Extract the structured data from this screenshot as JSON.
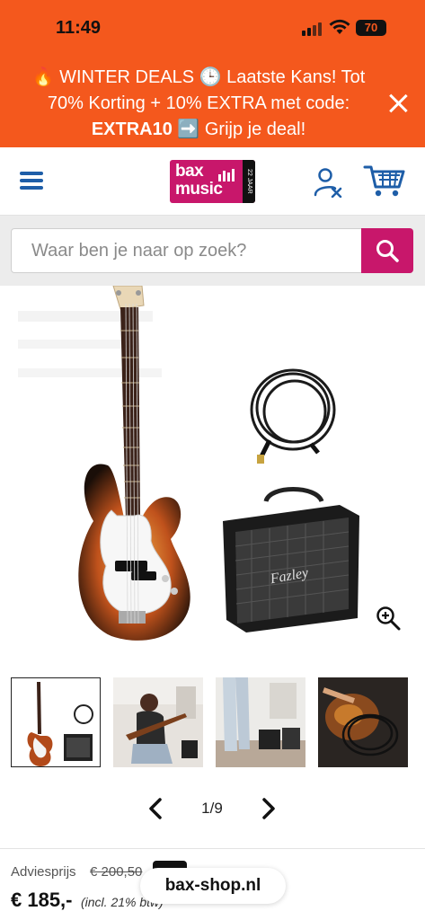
{
  "status_bar": {
    "time": "11:49",
    "battery": "70"
  },
  "promo": {
    "line1": "🔥 WINTER DEALS 🕒 Laatste Kans! Tot",
    "line2": "70% Korting + 10% EXTRA met code:",
    "code": "EXTRA10",
    "line3_tail": " ➡️ Grijp je deal!"
  },
  "header": {
    "logo_line1": "bax",
    "logo_line2": "music",
    "logo_side": "22 JAAR"
  },
  "search": {
    "placeholder": "Waar ben je naar op zoek?"
  },
  "gallery": {
    "amp_brand": "Fazley",
    "thumbnails": [
      {
        "name": "thumb-bass-set"
      },
      {
        "name": "thumb-woman-playing"
      },
      {
        "name": "thumb-person-amp"
      },
      {
        "name": "thumb-cable-closeup"
      }
    ]
  },
  "pager": {
    "count": "1/9"
  },
  "pricing": {
    "advies_label": "Adviesprijs",
    "advies_price": "€ 200,50",
    "price": "€ 185,-",
    "vat": "(incl. 21% btw)"
  },
  "browser": {
    "url": "bax-shop.nl"
  },
  "colors": {
    "promo_bg": "#f4581d",
    "brand": "#c8176b",
    "icon_blue": "#1e5ea8"
  }
}
